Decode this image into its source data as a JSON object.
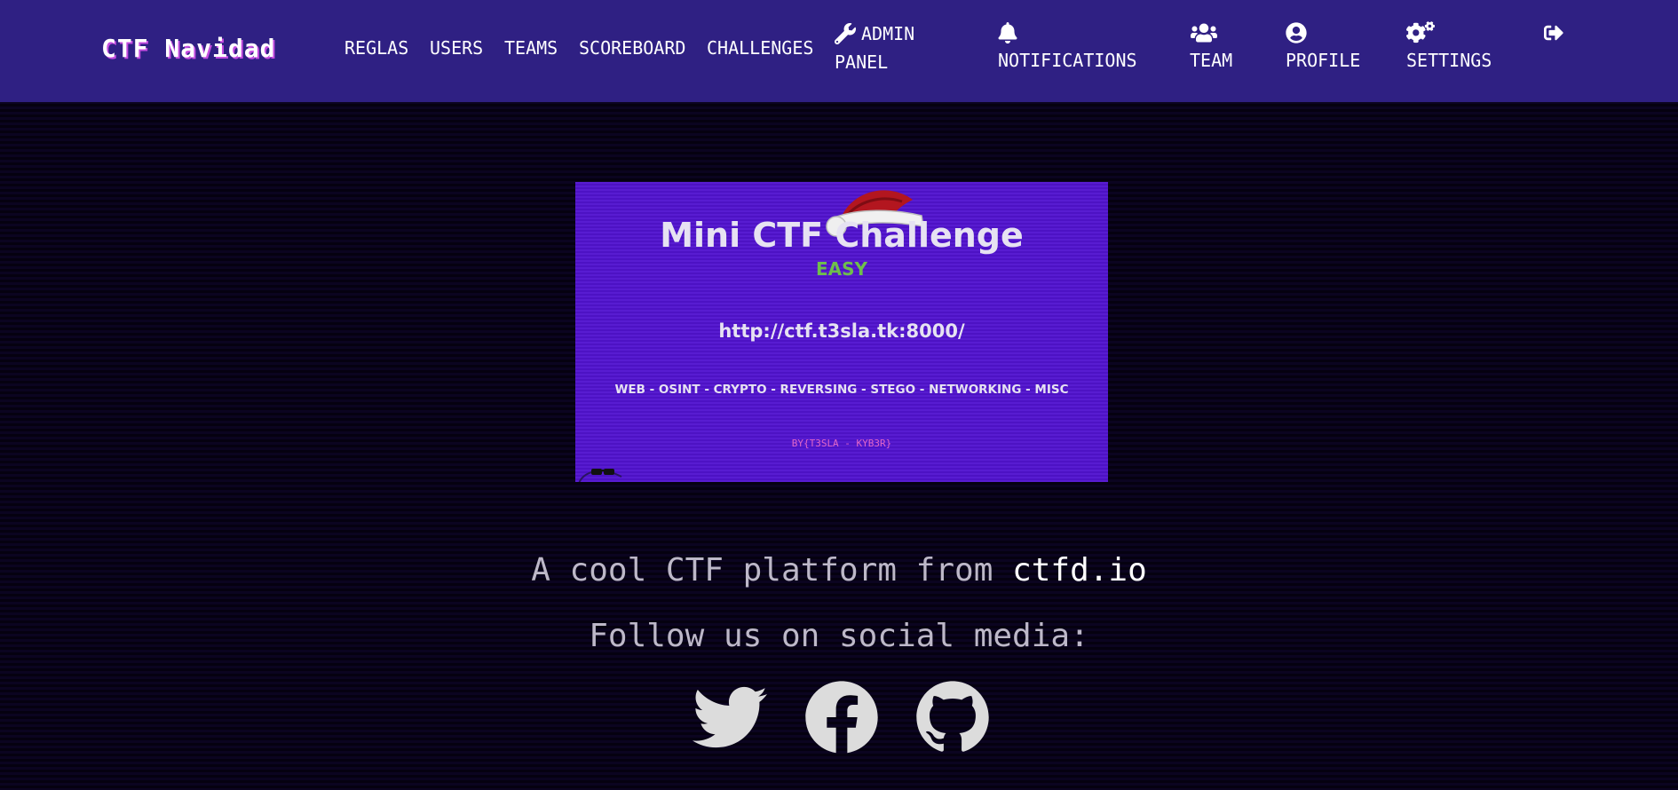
{
  "navbar": {
    "brand": "CTF Navidad",
    "links": [
      {
        "label": "REGLAS"
      },
      {
        "label": "USERS"
      },
      {
        "label": "TEAMS"
      },
      {
        "label": "SCOREBOARD"
      },
      {
        "label": "CHALLENGES"
      }
    ],
    "right": {
      "admin_line1": "ADMIN",
      "admin_line2": "PANEL",
      "notifications": "NOTIFICATIONS",
      "team": "TEAM",
      "profile": "PROFILE",
      "settings": "SETTINGS"
    },
    "icons": {
      "admin": "wrench-icon",
      "notifications": "bell-icon",
      "team": "users-icon",
      "profile": "user-circle-icon",
      "settings": "cogs-icon",
      "logout": "sign-out-icon"
    }
  },
  "banner": {
    "title": "Mini CTF Challenge",
    "level": "EASY",
    "url": "http://ctf.t3sla.tk:8000/",
    "categories": "WEB - OSINT - CRYPTO - REVERSING - STEGO - NETWORKING - MISC",
    "credits": "BY{T3SLA - KYB3R}"
  },
  "footer": {
    "tagline_prefix": "A cool CTF platform from ",
    "tagline_link": "ctfd.io",
    "follow": "Follow us on social media:",
    "social": [
      "twitter-icon",
      "facebook-icon",
      "github-icon"
    ]
  },
  "colors": {
    "navbar_bg": "#2f2083",
    "page_bg": "#0a0318",
    "banner_bg": "#5113cf",
    "level_green": "#6fbf4b",
    "credits_pink": "#e266c8",
    "text_muted": "#bdb8c8"
  }
}
